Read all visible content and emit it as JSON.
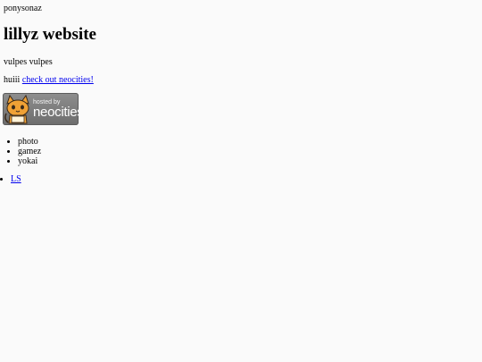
{
  "header": {
    "site_name": "ponysonaz"
  },
  "main": {
    "title": "lillyz website",
    "tagline": "vulpes vulpes",
    "greeting": "huiii",
    "neocities_link": "check out neocities!"
  },
  "badge": {
    "hosted_by": "hosted by",
    "brand": "neocities",
    "colors": {
      "background": "#7d7d7d",
      "cat_orange": "#f0a135"
    }
  },
  "nav": {
    "items": [
      {
        "label": "photo"
      },
      {
        "label": "gamez"
      },
      {
        "label": "yokai"
      }
    ]
  },
  "footer_links": {
    "items": [
      {
        "label": "LS"
      }
    ]
  }
}
